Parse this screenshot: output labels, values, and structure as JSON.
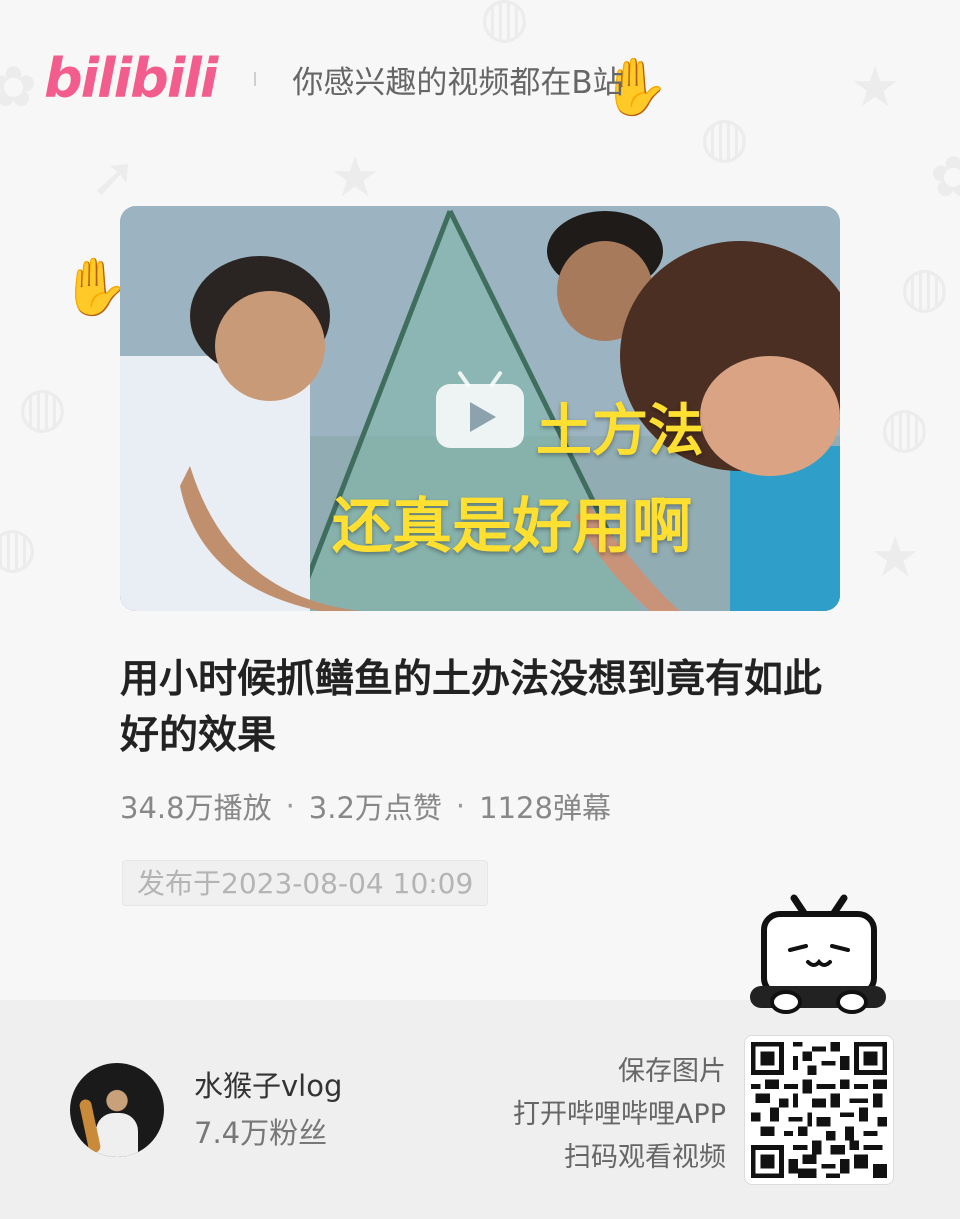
{
  "header": {
    "logo_text": "bilibili",
    "slogan": "你感兴趣的视频都在B站"
  },
  "video": {
    "cover_overlay_line1": "土方法",
    "cover_overlay_line2": "还真是好用啊",
    "title": "用小时候抓鳝鱼的土办法没想到竟有如此好的效果",
    "plays": "34.8万播放",
    "likes": "3.2万点赞",
    "danmaku": "1128弹幕",
    "dot": "·",
    "publish_time": "发布于2023-08-04 10:09"
  },
  "uploader": {
    "name": "水猴子vlog",
    "fans": "7.4万粉丝"
  },
  "qr": {
    "line1": "保存图片",
    "line2": "打开哔哩哔哩APP",
    "line3": "扫码观看视频"
  },
  "colors": {
    "brand_pink": "#f25d8e",
    "overlay_yellow": "#ffe030"
  },
  "icons": {
    "play": "play-icon",
    "mascot": "bilibili-tv-mascot",
    "qr": "qr-code"
  }
}
